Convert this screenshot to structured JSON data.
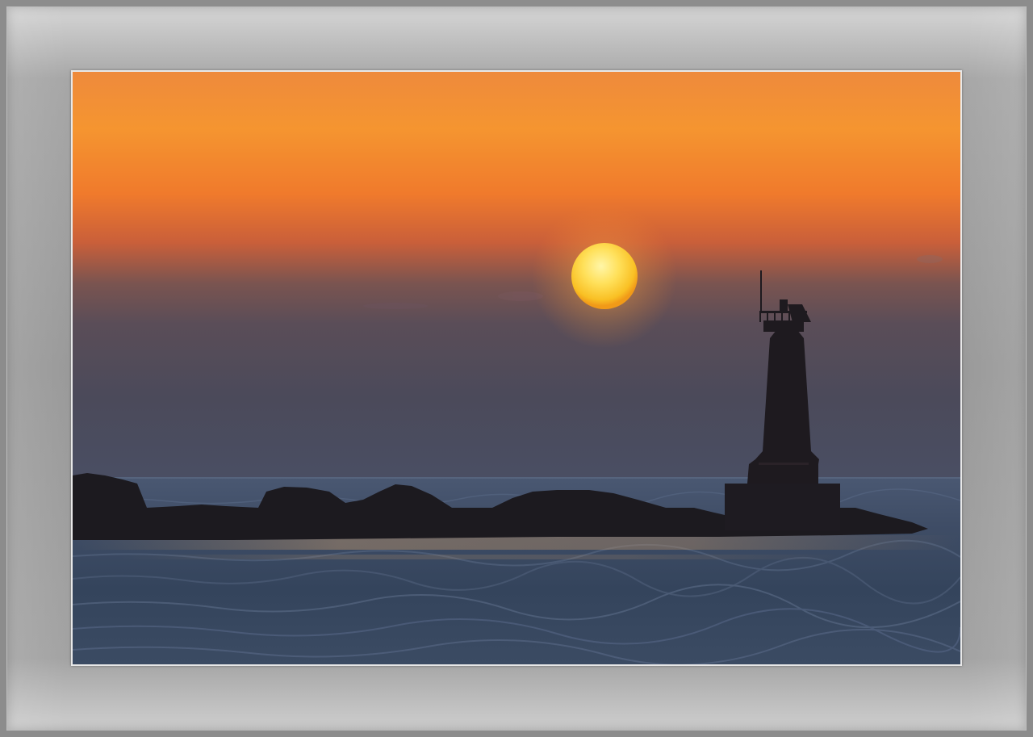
{
  "image": {
    "subject": "lighthouse-at-sunrise",
    "palette": {
      "sky_top": "#f08a3a",
      "sky_mid": "#e8742e",
      "haze": "#5a4a55",
      "sea": "#3b4a5f",
      "sun_core": "#ffe36a",
      "sun_edge": "#f7b31d",
      "silhouette": "#1b1a20",
      "frame": "#9a9a9a"
    }
  }
}
